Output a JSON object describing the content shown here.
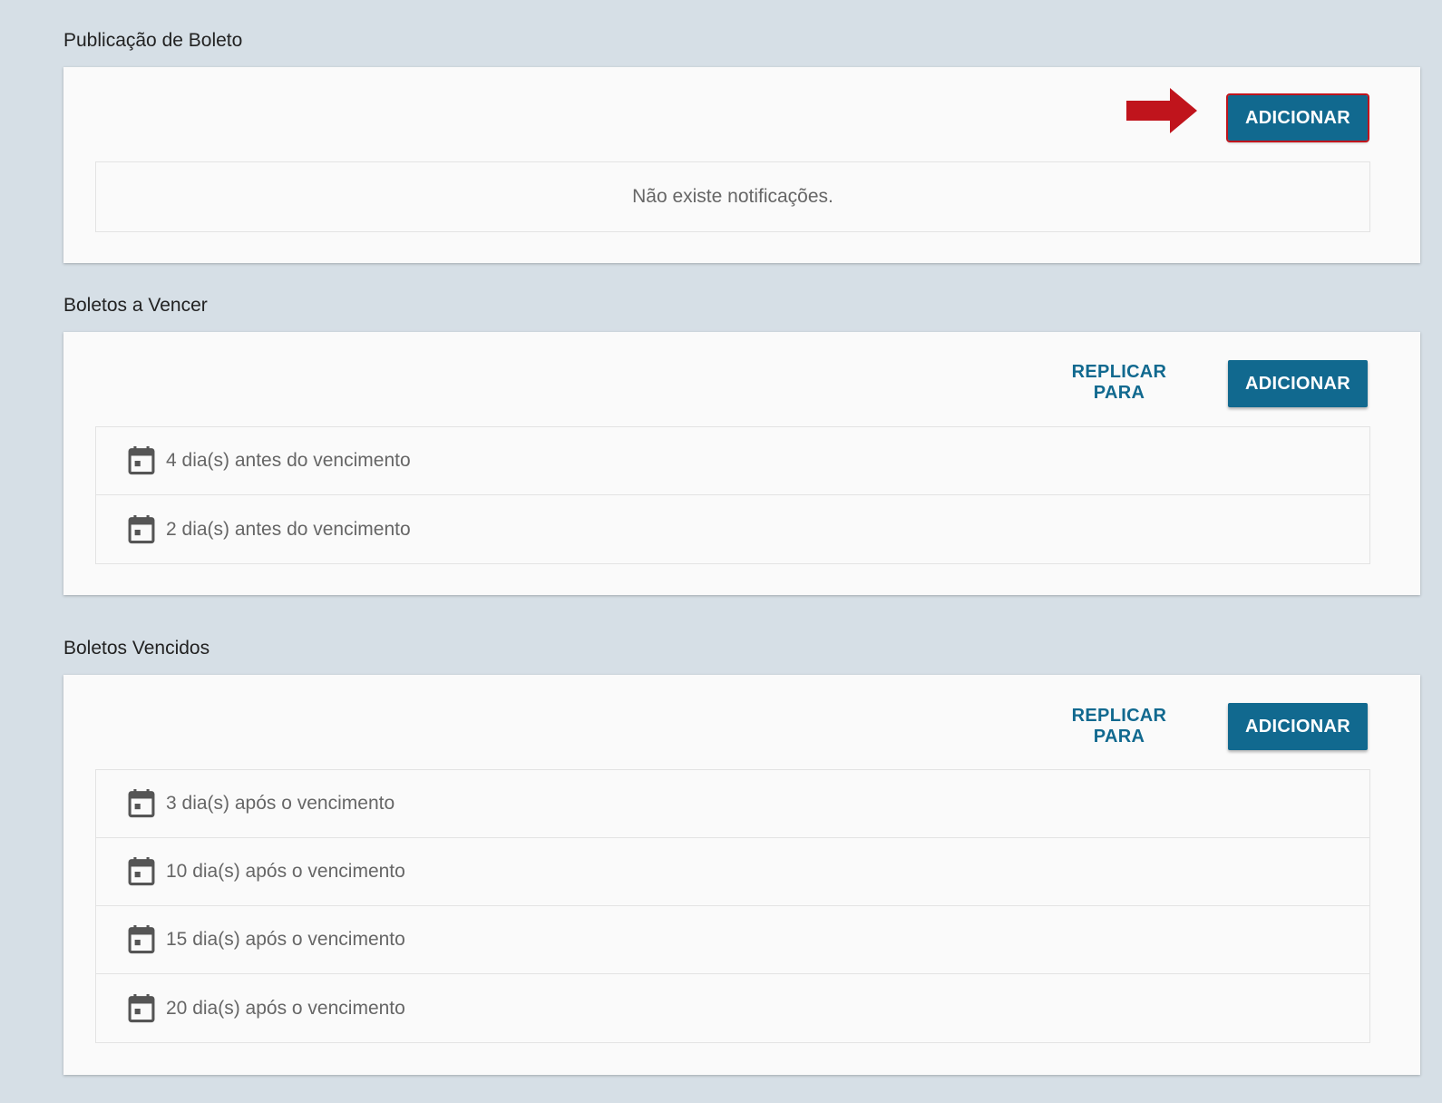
{
  "sections": [
    {
      "title": "Publicação de Boleto",
      "add_label": "ADICIONAR",
      "empty_message": "Não existe notificações."
    },
    {
      "title": "Boletos a Vencer",
      "replicate_label": "REPLICAR PARA",
      "add_label": "ADICIONAR",
      "items": [
        {
          "label": "4 dia(s) antes do vencimento",
          "icon": "calendar-icon"
        },
        {
          "label": "2 dia(s) antes do vencimento",
          "icon": "calendar-icon"
        }
      ]
    },
    {
      "title": "Boletos Vencidos",
      "replicate_label": "REPLICAR PARA",
      "add_label": "ADICIONAR",
      "items": [
        {
          "label": "3 dia(s) após o vencimento",
          "icon": "calendar-icon"
        },
        {
          "label": "10 dia(s) após o vencimento",
          "icon": "calendar-icon"
        },
        {
          "label": "15 dia(s) após o vencimento",
          "icon": "calendar-icon"
        },
        {
          "label": "20 dia(s) após o vencimento",
          "icon": "calendar-icon"
        }
      ]
    }
  ],
  "colors": {
    "background": "#d6dfe6",
    "card": "#fafafa",
    "primary": "#11698f",
    "annotation_red": "#c0141c",
    "muted_text": "#666666"
  }
}
